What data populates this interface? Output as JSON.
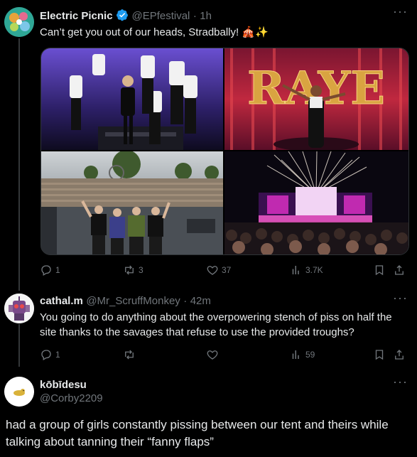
{
  "tweet1": {
    "name": "Electric Picnic",
    "handle": "@EPfestival",
    "sep": "·",
    "time": "1h",
    "text": "Can’t get you out of our heads, Stradbally! 🎪✨",
    "actions": {
      "reply": "1",
      "retweet": "3",
      "like": "37",
      "views": "3.7K"
    },
    "images": [
      {
        "scene": "dancers on stage"
      },
      {
        "scene": "RAYE on stage",
        "sign": "RAYE"
      },
      {
        "scene": "band waving at crowd"
      },
      {
        "scene": "night stage with fireworks"
      }
    ]
  },
  "tweet2": {
    "name": "cathal.m",
    "handle": "@Mr_ScruffMonkey",
    "sep": "·",
    "time": "42m",
    "text": "You going to do anything about the overpowering stench of piss on half the site thanks to the savages that refuse to use the provided troughs?",
    "actions": {
      "reply": "1",
      "retweet": "",
      "like": "",
      "views": "59"
    }
  },
  "tweet3": {
    "name": "kōbīdesu",
    "handle": "@Corby2209",
    "text": "had a group of girls constantly pissing between our tent and theirs while talking about tanning their “fanny flaps”"
  },
  "colors": {
    "bg": "#000000",
    "text": "#e7e9ea",
    "muted": "#71767b",
    "verified": "#1d9bf0",
    "line": "#333639"
  }
}
